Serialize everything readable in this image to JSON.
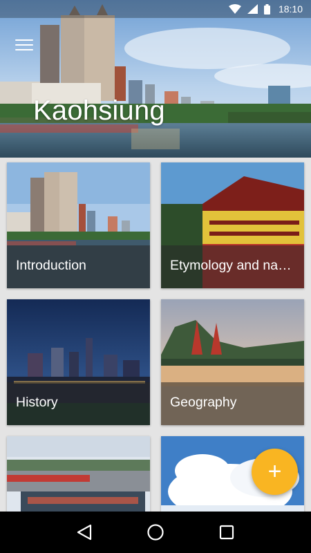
{
  "status_bar": {
    "time": "18:10"
  },
  "hero": {
    "title": "Kaohsiung"
  },
  "cards": [
    {
      "caption": "Introduction"
    },
    {
      "caption": "Etymology and names"
    },
    {
      "caption": "History"
    },
    {
      "caption": "Geography"
    },
    {
      "caption": ""
    },
    {
      "caption": ""
    }
  ],
  "fab": {
    "symbol": "+"
  },
  "icons": {
    "menu": "menu-icon",
    "wifi": "wifi-icon",
    "signal": "signal-icon",
    "battery": "battery-icon",
    "back": "back-icon",
    "home": "home-icon",
    "recents": "recents-icon"
  },
  "colors": {
    "accent": "#f9b522",
    "navbar": "#000000",
    "caption_overlay": "#282828"
  }
}
